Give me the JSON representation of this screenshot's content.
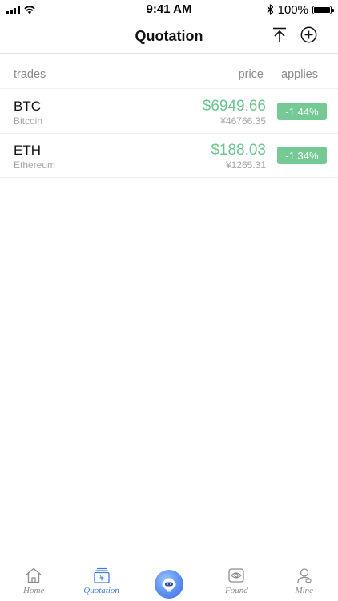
{
  "status_bar": {
    "time": "9:41 AM",
    "battery_text": "100%"
  },
  "nav": {
    "title": "Quotation"
  },
  "table_header": {
    "trades": "trades",
    "price": "price",
    "applies": "applies"
  },
  "rows": [
    {
      "symbol": "BTC",
      "name": "Bitcoin",
      "price_usd": "$6949.66",
      "price_cny": "¥46766.35",
      "change": "-1.44%"
    },
    {
      "symbol": "ETH",
      "name": "Ethereum",
      "price_usd": "$188.03",
      "price_cny": "¥1265.31",
      "change": "-1.34%"
    }
  ],
  "tabs": [
    {
      "label": "Home",
      "icon": "home-icon",
      "active": false
    },
    {
      "label": "Quotation",
      "icon": "quotation-icon",
      "active": true
    },
    {
      "label": "",
      "icon": "robot-icon",
      "active": false
    },
    {
      "label": "Found",
      "icon": "found-icon",
      "active": false
    },
    {
      "label": "Mine",
      "icon": "mine-icon",
      "active": false
    }
  ],
  "colors": {
    "price_green": "#6cc48f",
    "badge_green": "#74c994",
    "active_blue": "#3b7cde",
    "inactive_gray": "#8c8c8c"
  }
}
